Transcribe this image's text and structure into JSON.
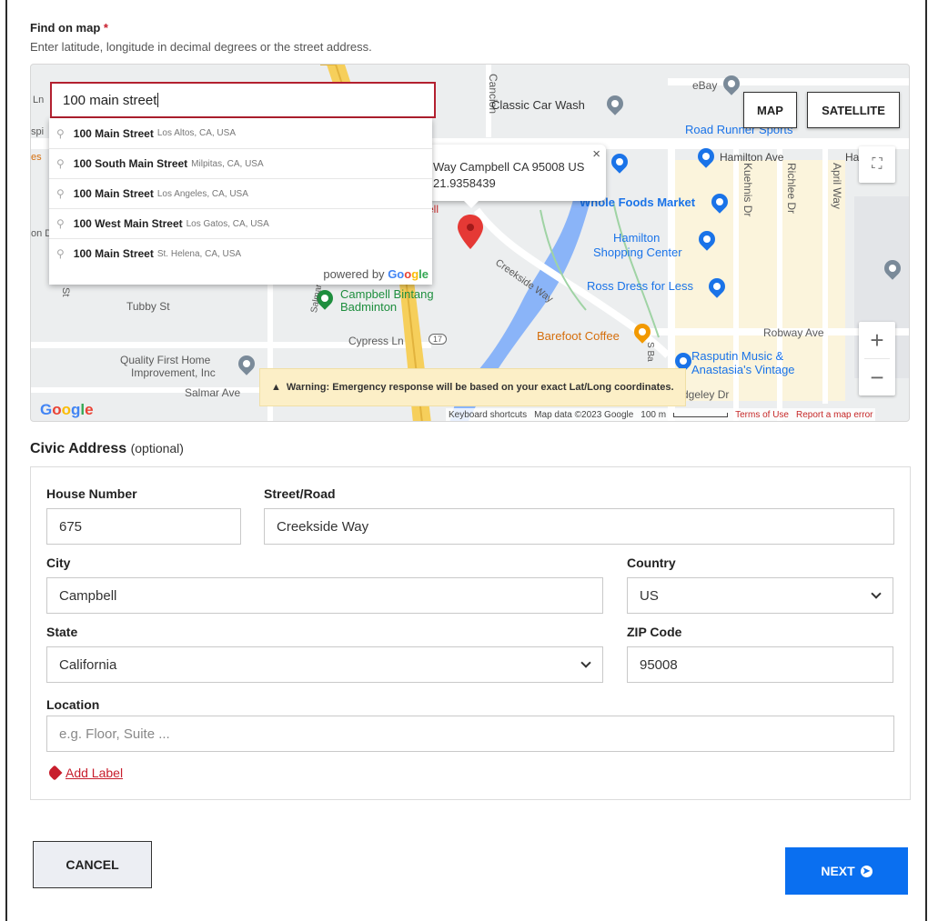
{
  "find_on_map": {
    "label": "Find on map",
    "required_mark": "*",
    "hint": "Enter latitude, longitude in decimal degrees or the street address."
  },
  "map": {
    "search_value": "100 main street",
    "map_button": "MAP",
    "satellite_button": "SATELLITE",
    "infowindow": {
      "line1": "Way Campbell CA 95008 US",
      "line2": "21.9358439",
      "close": "×"
    },
    "warning": "Warning: Emergency response will be based on your exact Lat/Long coordinates.",
    "warning_icon": "▲",
    "attribution": {
      "shortcuts": "Keyboard shortcuts",
      "data": "Map data ©2023 Google",
      "scale": "100 m",
      "terms": "Terms of Use",
      "report": "Report a map error"
    },
    "logo": [
      "G",
      "o",
      "o",
      "g",
      "l",
      "e"
    ],
    "zoom_in": "+",
    "zoom_out": "−",
    "fullscreen_icon": "⛶",
    "labels": {
      "cancion": "Cancion",
      "car_wash": "Classic Car Wash",
      "ebay": "eBay",
      "road_runner": "Road Runner Sports",
      "hamilton_ave": "Hamilton Ave",
      "hamilton_ave2": "Har",
      "kuehnis": "Kuehnis Dr",
      "richlee": "Richlee Dr",
      "april": "April Way",
      "whole_foods": "Whole Foods Market",
      "hamilton_sc1": "Hamilton",
      "hamilton_sc2": "Shopping Center",
      "creekside": "Creekside Way",
      "ross": "Ross Dress for Less",
      "campbell_bintang1": "Campbell Bintang",
      "campbell_bintang2": "Badminton",
      "tubby": "Tubby St",
      "salmar_ave_v": "Salmar Ave",
      "cypress": "Cypress Ln",
      "route17": "17",
      "barefoot": "Barefoot Coffee",
      "robway": "Robway Ave",
      "quality1": "Quality First Home",
      "quality2": "Improvement, Inc",
      "salmar_ave": "Salmar Ave",
      "rasputin1": "Rasputin Music &",
      "rasputin2": "Anastasia's Vintage",
      "edgeley": "dgeley Dr",
      "sba": "S Ba",
      "left_ln": "Ln",
      "left_spi": "spi",
      "left_es": "es",
      "left_ond": "on D",
      "left_st": "St",
      "ell": "ell"
    }
  },
  "autocomplete": {
    "items": [
      {
        "main": "100 Main Street",
        "secondary": "Los Altos, CA, USA"
      },
      {
        "main": "100 South Main Street",
        "secondary": "Milpitas, CA, USA"
      },
      {
        "main": "100 Main Street",
        "secondary": "Los Angeles, CA, USA"
      },
      {
        "main": "100 West Main Street",
        "secondary": "Los Gatos, CA, USA"
      },
      {
        "main": "100 Main Street",
        "secondary": "St. Helena, CA, USA"
      }
    ],
    "powered_by": "powered by",
    "google": [
      "Go",
      "o",
      "g",
      "le"
    ]
  },
  "civic": {
    "title": "Civic Address",
    "optional": "(optional)",
    "house_number_label": "House Number",
    "house_number": "675",
    "street_label": "Street/Road",
    "street": "Creekside Way",
    "city_label": "City",
    "city": "Campbell",
    "country_label": "Country",
    "country": "US",
    "state_label": "State",
    "state": "California",
    "zip_label": "ZIP Code",
    "zip": "95008",
    "location_label": "Location",
    "location_placeholder": "e.g. Floor, Suite ...",
    "add_label": "Add Label"
  },
  "buttons": {
    "cancel": "CANCEL",
    "next": "NEXT"
  },
  "colors": {
    "accent_red": "#c81e2d",
    "primary_blue": "#0a6ff0",
    "warning_bg": "#fcefc7"
  }
}
